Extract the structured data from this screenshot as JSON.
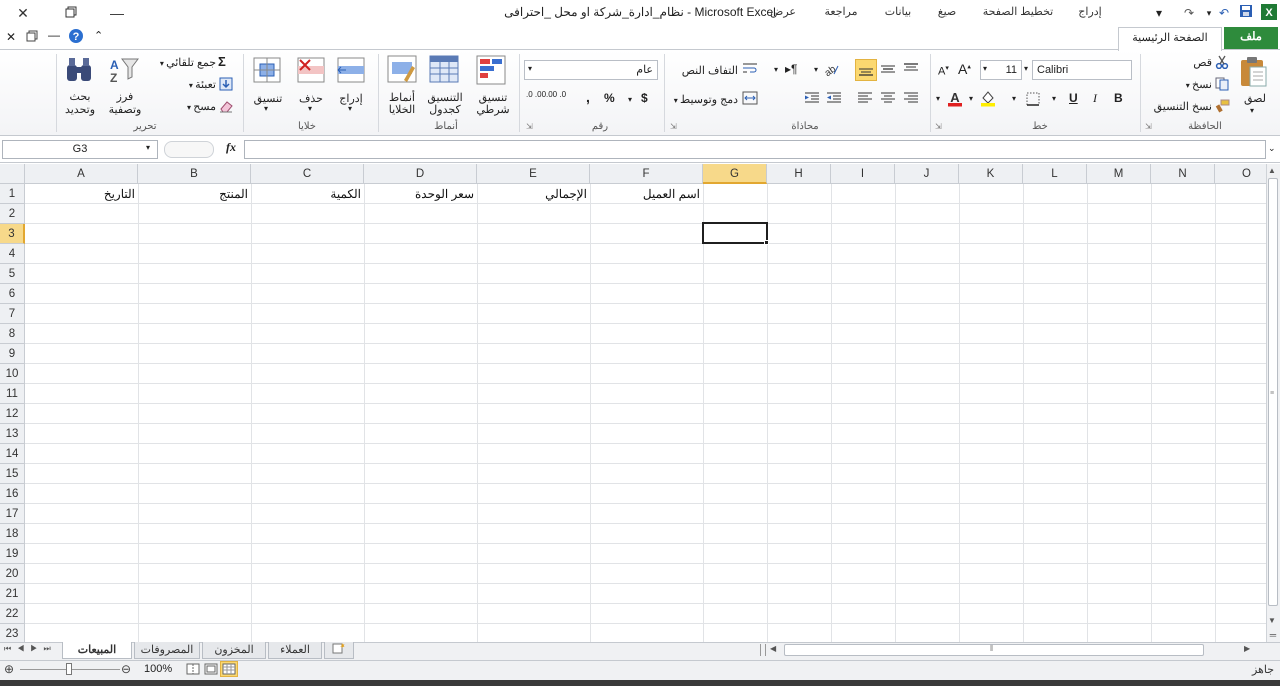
{
  "window": {
    "title": "نظام_ادارة_شركة او محل _احترافى  -  Microsoft Excel"
  },
  "ribbon_tabs": {
    "file": "ملف",
    "home": "الصفحة الرئيسية",
    "insert": "إدراج",
    "page_layout": "تخطيط الصفحة",
    "formulas": "صيغ",
    "data": "بيانات",
    "review": "مراجعة",
    "view": "عرض"
  },
  "clipboard": {
    "label": "الحافظة",
    "paste": "لصق",
    "cut": "قص",
    "copy": "نسخ",
    "format_painter": "نسخ التنسيق"
  },
  "font": {
    "label": "خط",
    "name": "Calibri",
    "size": "11",
    "bold": "B",
    "italic": "I",
    "underline": "U",
    "grow": "A",
    "shrink": "A"
  },
  "alignment": {
    "label": "محاذاة",
    "wrap_text": "التفاف النص",
    "merge_center": "دمج وتوسيط"
  },
  "number": {
    "label": "رقم",
    "format": "عام",
    "currency": "$",
    "percent": "%",
    "comma": ",",
    "inc_decimal": ".0 .00",
    "dec_decimal": ".00 .0"
  },
  "styles": {
    "label": "أنماط",
    "conditional": "تنسيق شرطي",
    "format_table": "التنسيق كجدول",
    "cell_styles": "أنماط الخلايا"
  },
  "cells": {
    "label": "خلايا",
    "insert": "إدراج",
    "delete": "حذف",
    "format": "تنسيق"
  },
  "editing": {
    "label": "تحرير",
    "autosum": "جمع تلقائي",
    "fill": "تعبئة",
    "clear": "مسح",
    "sort_filter": "فرز وتصفية",
    "find_select": "بحث وتحديد"
  },
  "formula_bar": {
    "name_box": "G3",
    "fx": "fx",
    "value": ""
  },
  "columns": [
    "A",
    "B",
    "C",
    "D",
    "E",
    "F",
    "G",
    "H",
    "I",
    "J",
    "K",
    "L",
    "M",
    "N",
    "O"
  ],
  "rows": [
    "1",
    "2",
    "3",
    "4",
    "5",
    "6",
    "7",
    "8",
    "9",
    "10",
    "11",
    "12",
    "13",
    "14",
    "15",
    "16",
    "17",
    "18",
    "19",
    "20",
    "21",
    "22",
    "23"
  ],
  "row1_cells": {
    "A": "التاريخ",
    "B": "المنتج",
    "C": "الكمية",
    "D": "سعر الوحدة",
    "E": "الإجمالي",
    "F": "اسم العميل"
  },
  "selected_cell": "G3",
  "sheets": {
    "active": "المبيعات",
    "list": [
      "المبيعات",
      "المصروفات",
      "المخزون",
      "العملاء"
    ]
  },
  "status": {
    "ready": "جاهز",
    "zoom": "100%"
  },
  "colors": {
    "file_tab": "#2e8b3c",
    "selection": "#1f1f1f",
    "active_header": "#f7d98a"
  }
}
